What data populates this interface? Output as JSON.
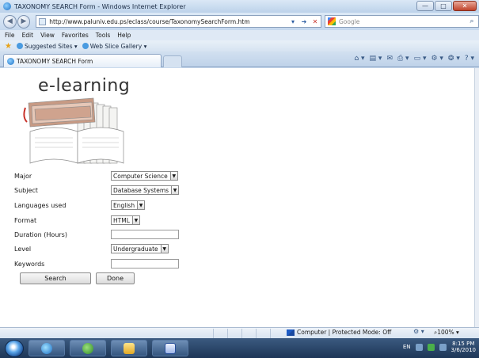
{
  "window": {
    "title": "TAXONOMY SEARCH Form - Windows Internet Explorer",
    "buttons": {
      "minimize": "—",
      "maximize": "□",
      "close": "✕"
    }
  },
  "navbar": {
    "url": "http://www.paluniv.edu.ps/eclass/course/TaxonomySearchForm.htm",
    "search_placeholder": "Google",
    "back": "◀",
    "forward": "▶",
    "dropdown": "▾",
    "go": "➜",
    "stop": "✕",
    "search_icon": "⌕"
  },
  "menu": [
    "File",
    "Edit",
    "View",
    "Favorites",
    "Tools",
    "Help"
  ],
  "favorites": {
    "star": "★",
    "items": [
      "Suggested Sites ▾",
      "Web Slice Gallery ▾"
    ]
  },
  "tab": {
    "label": "TAXONOMY SEARCH Form"
  },
  "commandbar": [
    "⌂ ▾",
    "▤ ▾",
    "✉",
    "⎙ ▾",
    "▭ ▾",
    "⚙ ▾",
    "❂ ▾",
    "? ▾"
  ],
  "logo": {
    "text": "e-learning"
  },
  "form": {
    "rows": [
      {
        "label": "Major",
        "type": "select",
        "value": "Computer Science"
      },
      {
        "label": "Subject",
        "type": "select",
        "value": "Database Systems"
      },
      {
        "label": "Languages used",
        "type": "select",
        "value": "English"
      },
      {
        "label": "Format",
        "type": "select",
        "value": "HTML"
      },
      {
        "label": "Duration (Hours)",
        "type": "text",
        "value": ""
      },
      {
        "label": "Level",
        "type": "select",
        "value": "Undergraduate"
      },
      {
        "label": "Keywords",
        "type": "text",
        "value": ""
      }
    ],
    "select_arrow": "▼",
    "search_label": "Search",
    "done_label": "Done"
  },
  "status": {
    "zone": "Computer | Protected Mode: Off",
    "zoom": "100%  ▾",
    "gear": "⚙ ▾",
    "zoom_icon": "⌕"
  },
  "taskbar": {
    "lang": "EN",
    "time": "8:15 PM",
    "date": "3/6/2010"
  },
  "colors": {
    "chrome": "#c8d9ec",
    "taskbar": "#1d3657",
    "close": "#c0432b"
  }
}
